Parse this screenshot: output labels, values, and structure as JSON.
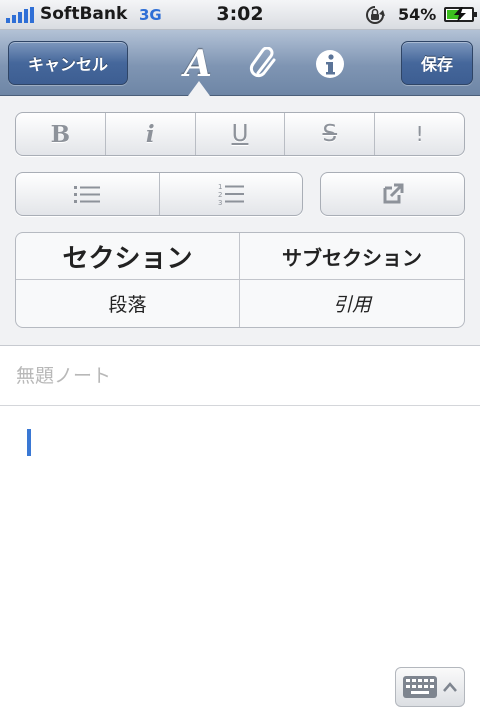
{
  "status_bar": {
    "carrier": "SoftBank",
    "network": "3G",
    "time": "3:02",
    "battery_percent": "54%",
    "battery_level": 0.54,
    "signal_icon": "signal-bars-icon",
    "rotation_lock_icon": "rotation-lock-icon",
    "battery_icon": "battery-charging-icon"
  },
  "nav_bar": {
    "cancel_label": "キャンセル",
    "font_glyph": "A",
    "save_label": "保存",
    "icons": [
      "font-format-icon",
      "paperclip-icon",
      "info-icon"
    ]
  },
  "format_panel": {
    "text_styles": [
      "B",
      "i",
      "U",
      "S",
      "!"
    ],
    "list_icons": [
      "bulleted-list-icon",
      "numbered-list-icon"
    ],
    "link_icon": "external-link-icon",
    "headings": {
      "section": "セクション",
      "subsection": "サブセクション",
      "paragraph": "段落",
      "quote": "引用"
    }
  },
  "note": {
    "title_placeholder": "無題ノート",
    "title_value": "",
    "body": ""
  },
  "keyboard_toggle_icon": "keyboard-icon",
  "colors": {
    "nav_bar": "#7f95b3",
    "nav_button": "#45679b",
    "accent_blue": "#2f6fd6",
    "cursor": "#3a78d4",
    "battery_green": "#3bbf1f",
    "panel_bg": "#f1f2f4"
  }
}
